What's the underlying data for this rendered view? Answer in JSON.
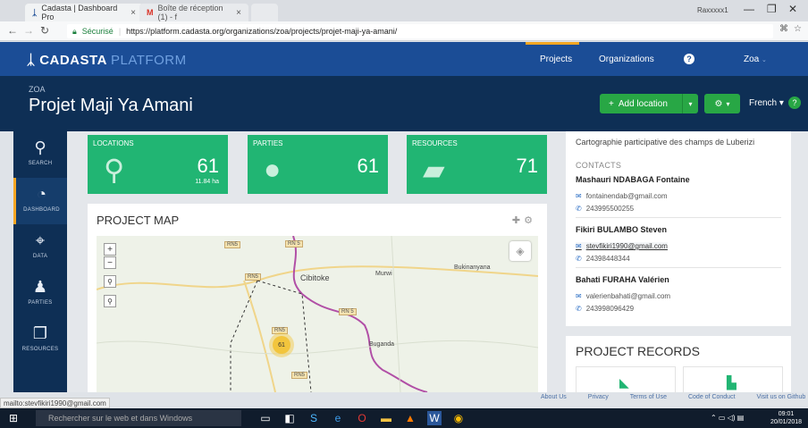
{
  "browser": {
    "tabs": [
      {
        "label": "Cadasta | Dashboard Pro",
        "icon": "cadasta-icon"
      },
      {
        "label": "Boîte de réception (1) - f",
        "icon": "gmail-icon"
      }
    ],
    "profile": "Raxxxxx1",
    "secure_label": "Sécurisé",
    "url": "https://platform.cadasta.org/organizations/zoa/projects/projet-maji-ya-amani/"
  },
  "nav": {
    "logo_main": "CADASTA",
    "logo_sub": "PLATFORM",
    "projects": "Projects",
    "organizations": "Organizations",
    "help": "?",
    "user": "Zoa"
  },
  "header": {
    "org": "ZOA",
    "title": "Projet Maji Ya Amani",
    "add_location": "Add location",
    "language": "French",
    "help_badge": "?"
  },
  "sidebar": {
    "items": [
      {
        "label": "SEARCH",
        "icon": "search-icon"
      },
      {
        "label": "DASHBOARD",
        "icon": "dashboard-icon"
      },
      {
        "label": "DATA",
        "icon": "data-icon"
      },
      {
        "label": "PARTIES",
        "icon": "parties-icon"
      },
      {
        "label": "RESOURCES",
        "icon": "resources-icon"
      }
    ],
    "active": "DASHBOARD"
  },
  "stats": {
    "locations": {
      "title": "LOCATIONS",
      "value": "61",
      "sub": "11.84 ha"
    },
    "parties": {
      "title": "PARTIES",
      "value": "61"
    },
    "resources": {
      "title": "RESOURCES",
      "value": "71"
    }
  },
  "map": {
    "title": "PROJECT MAP",
    "zoom_in": "+",
    "zoom_out": "−",
    "towns": [
      "Cibitoke",
      "Murwi",
      "Bukinanyana",
      "Buganda"
    ],
    "roads": [
      "RN5",
      "RN 5",
      "RN5",
      "RN 5",
      "RN5",
      "RN5"
    ],
    "cluster_count": "61"
  },
  "project_info": {
    "description": "Cartographie participative des champs de Luberizi",
    "contacts_label": "CONTACTS",
    "contacts": [
      {
        "name": "Mashauri NDABAGA Fontaine",
        "email": "fontainendab@gmail.com",
        "phone": "243995500255"
      },
      {
        "name": "Fikiri BULAMBO Steven",
        "email": "stevfikiri1990@gmail.com",
        "phone": "24398448344"
      },
      {
        "name": "Bahati FURAHA Valérien",
        "email": "valerienbahati@gmail.com",
        "phone": "243998096429"
      }
    ]
  },
  "records": {
    "title": "PROJECT RECORDS"
  },
  "status_url": "mailto:stevfikiri1990@gmail.com",
  "footer": {
    "links": [
      "About Us",
      "Privacy",
      "Terms of Use",
      "Code of Conduct",
      "Visit us on Github"
    ]
  },
  "taskbar": {
    "search_placeholder": "Rechercher sur le web et dans Windows",
    "time": "09:01",
    "date": "20/01/2018"
  },
  "colors": {
    "nav_blue": "#1b4d96",
    "header_navy": "#0e2f55",
    "accent_green": "#21b573",
    "accent_orange": "#f5a623"
  }
}
